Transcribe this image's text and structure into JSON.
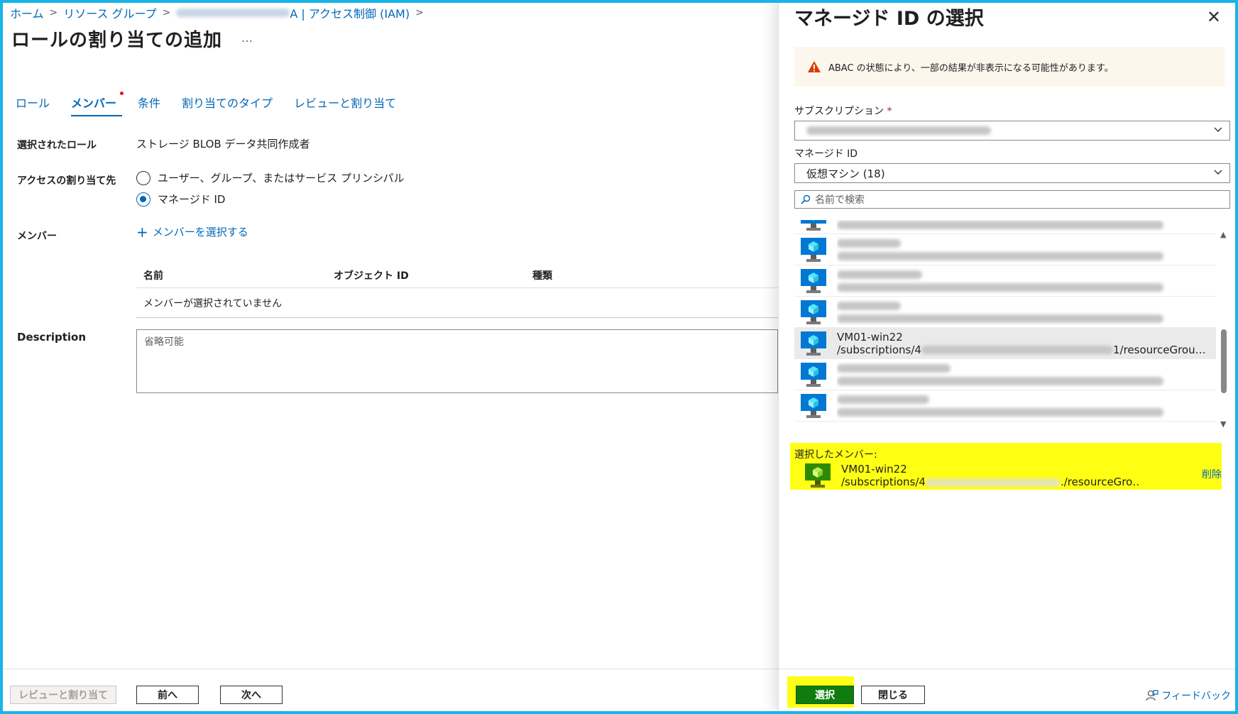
{
  "breadcrumb": {
    "home": "ホーム",
    "resource_groups": "リソース グループ",
    "resource_suffix": "A | アクセス制御 (IAM)"
  },
  "page": {
    "title": "ロールの割り当ての追加",
    "more": "…"
  },
  "tabs": [
    {
      "label": "ロール"
    },
    {
      "label": "メンバー"
    },
    {
      "label": "条件"
    },
    {
      "label": "割り当てのタイプ"
    },
    {
      "label": "レビューと割り当て"
    }
  ],
  "form": {
    "selected_role_label": "選択されたロール",
    "selected_role_value": "ストレージ BLOB データ共同作成者",
    "access_label": "アクセスの割り当て先",
    "access_option_1": "ユーザー、グループ、またはサービス プリンシパル",
    "access_option_2": "マネージド ID",
    "members_label": "メンバー",
    "add_members": "メンバーを選択する",
    "table_headers": [
      "名前",
      "オブジェクト ID",
      "種類"
    ],
    "no_members": "メンバーが選択されていません",
    "description_label": "Description",
    "description_placeholder": "省略可能"
  },
  "footer": {
    "review_assign": "レビューと割り当て",
    "prev": "前へ",
    "next": "次へ"
  },
  "panel": {
    "title": "マネージド ID の選択",
    "close": "✕",
    "warning": "ABAC の状態により、一部の結果が非表示になる可能性があります。",
    "subscription_label": "サブスクリプション",
    "required_mark": "*",
    "managed_id_label": "マネージド ID",
    "managed_id_value": "仮想マシン (18)",
    "search_placeholder": "名前で検索",
    "list_selected_name": "VM01-win22",
    "list_selected_path_prefix": "/subscriptions/4",
    "list_selected_path_suffix": "1/resourceGrou…",
    "selected_members_header": "選択したメンバー:",
    "selected_member_name": "VM01-win22",
    "selected_member_path_prefix": "/subscriptions/4",
    "selected_member_path_suffix": "./resourceGro…",
    "remove": "削除",
    "select_button": "選択",
    "close_button": "閉じる",
    "feedback": "フィードバック"
  },
  "colors": {
    "accent": "#0067b8",
    "primary_button": "#107c10",
    "highlight": "#ffff14",
    "frame": "#16b4e8",
    "warning_icon": "#d83b01"
  }
}
